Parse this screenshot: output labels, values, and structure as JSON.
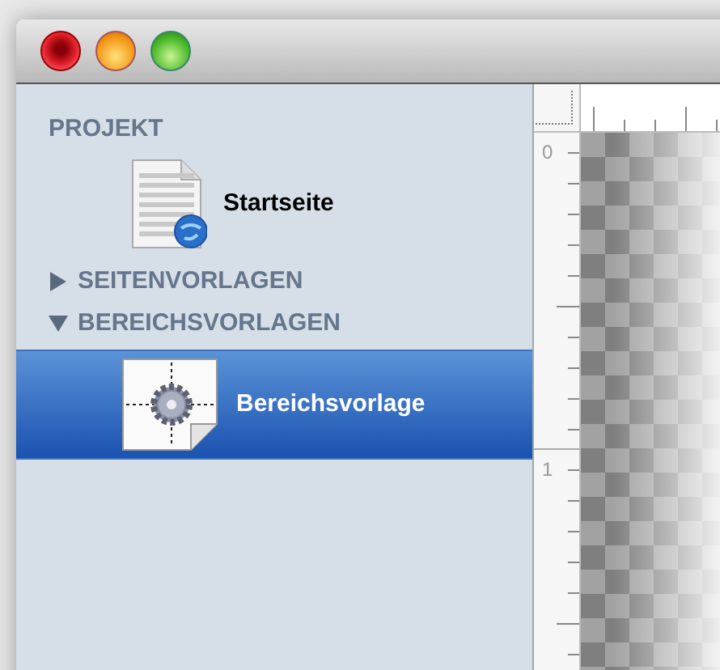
{
  "sidebar": {
    "groups": [
      {
        "title": "PROJEKT",
        "items": [
          {
            "label": "Startseite",
            "kind": "page",
            "selected": false
          }
        ]
      },
      {
        "title": "SEITENVORLAGEN",
        "expanded": false
      },
      {
        "title": "BEREICHSVORLAGEN",
        "expanded": true,
        "items": [
          {
            "label": "Bereichsvorlage",
            "kind": "region-template",
            "selected": true
          }
        ]
      }
    ]
  },
  "ruler": {
    "labels": [
      "0",
      "1"
    ]
  }
}
